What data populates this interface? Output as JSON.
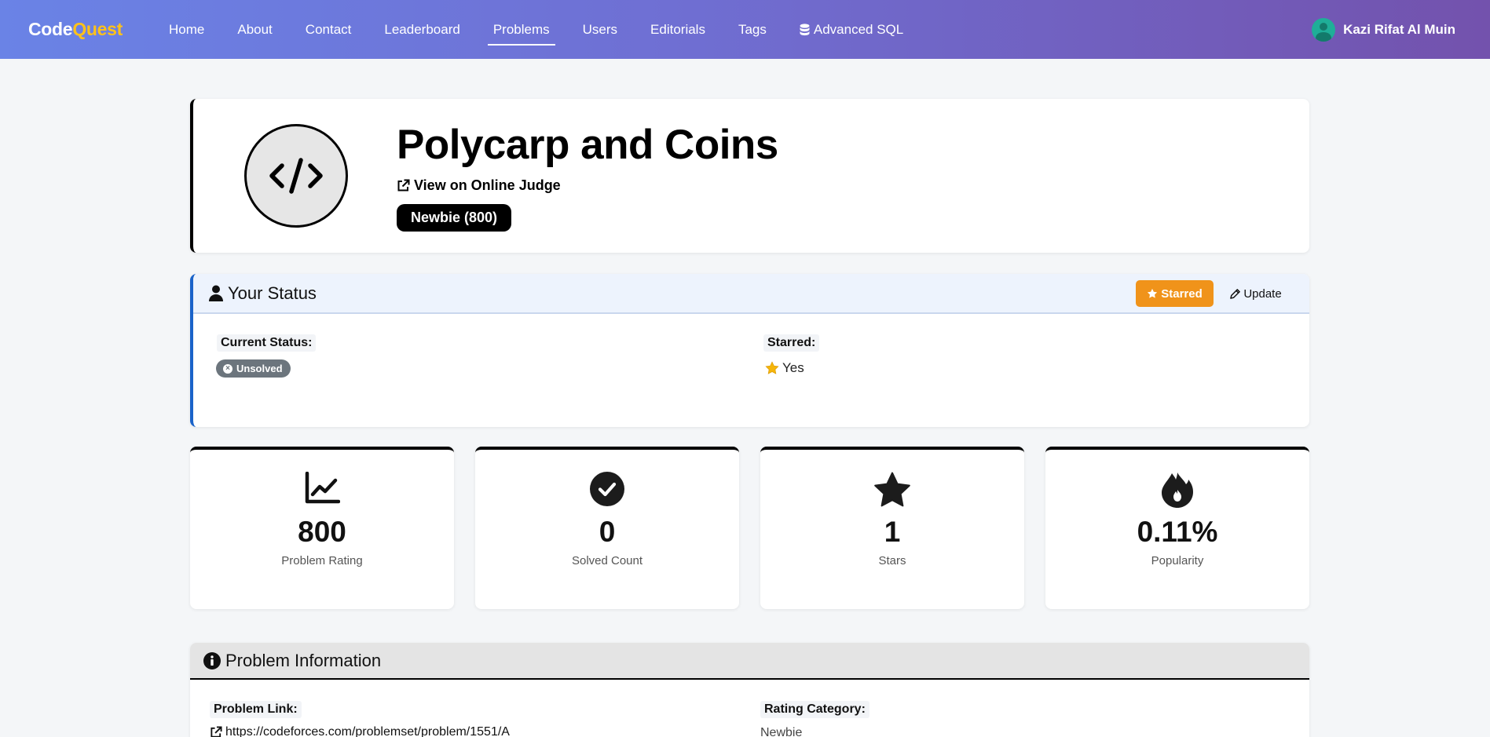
{
  "nav": {
    "brand_main": "Code",
    "brand_accent": "Quest",
    "links": [
      "Home",
      "About",
      "Contact",
      "Leaderboard",
      "Problems",
      "Users",
      "Editorials",
      "Tags",
      "Advanced SQL"
    ],
    "active": "Problems",
    "user_name": "Kazi Rifat Al Muin"
  },
  "problem": {
    "title": "Polycarp and Coins",
    "judge_link": "View on Online Judge",
    "badge": "Newbie (800)"
  },
  "status": {
    "title": "Your Status",
    "starred_button": "Starred",
    "update_button": "Update",
    "current_status_label": "Current Status:",
    "current_status_value": "Unsolved",
    "starred_label": "Starred:",
    "starred_value": "Yes"
  },
  "stats": [
    {
      "icon": "chart-line-icon",
      "value": "800",
      "caption": "Problem Rating"
    },
    {
      "icon": "check-circle-icon",
      "value": "0",
      "caption": "Solved Count"
    },
    {
      "icon": "star-icon",
      "value": "1",
      "caption": "Stars"
    },
    {
      "icon": "fire-icon",
      "value": "0.11%",
      "caption": "Popularity"
    }
  ],
  "info": {
    "title": "Problem Information",
    "problem_link_label": "Problem Link:",
    "problem_link_value": "https://codeforces.com/problemset/problem/1551/A",
    "rating_category_label": "Rating Category:",
    "rating_category_value": "Newbie"
  },
  "colors": {
    "starred_button": "#f0931a",
    "status_accent": "#1a63c9",
    "brand_accent": "#ffc21a",
    "star_yellow": "#f5b50a"
  }
}
